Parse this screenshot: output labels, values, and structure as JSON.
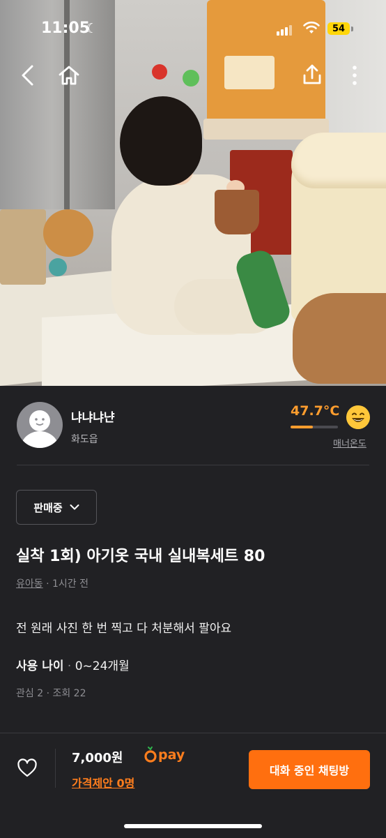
{
  "status_bar": {
    "time": "11:05",
    "moon_icon": "moon-icon",
    "battery": "54"
  },
  "nav": {
    "back_icon": "chevron-left-icon",
    "home_icon": "home-icon",
    "share_icon": "share-icon",
    "more_icon": "more-vertical-icon"
  },
  "seller": {
    "name": "냐냐냐냔",
    "location": "화도읍",
    "temperature": "47.7°C",
    "temperature_fraction": 0.477,
    "temperature_color": "#ff9d2e",
    "manner_label": "매너온도"
  },
  "product": {
    "status": "판매중",
    "title": "실착 1회) 아기옷 국내 실내복세트 80",
    "category": "유아동",
    "time_ago": "· 1시간 전",
    "description": "전 원래 사진 한 번 찍고 다 처분해서 팔아요",
    "age_label": "사용 나이",
    "age_sep": "·",
    "age_value": "0~24개월",
    "stats": "관심 2 · 조회 22"
  },
  "bottom": {
    "price": "7,000원",
    "pay_label": "pay",
    "offer": "가격제안 0명",
    "chat_button": "대화 중인 채팅방",
    "accent_color": "#ff6f0f"
  }
}
